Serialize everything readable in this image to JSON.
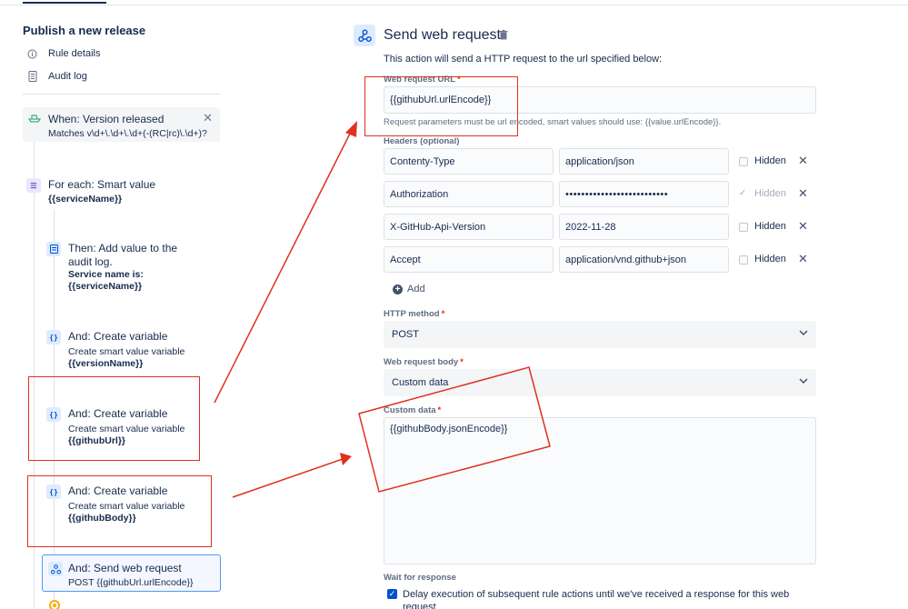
{
  "left": {
    "rule_title": "Publish a new release",
    "links": [
      {
        "label": "Rule details",
        "icon": "info-icon"
      },
      {
        "label": "Audit log",
        "icon": "document-icon"
      }
    ],
    "trigger": {
      "title": "When: Version released",
      "detail": "Matches v\\d+\\.\\d+\\.\\d+(-(RC|rc)\\.\\d+)?"
    },
    "foreach": {
      "title": "For each: Smart value",
      "value": "{{serviceName}}"
    },
    "then": {
      "title_line1": "Then: Add value to the",
      "title_line2": "audit log.",
      "bold_line1": "Service name is:",
      "bold_line2": "{{serviceName}}"
    },
    "create_vars": [
      {
        "title": "And: Create variable",
        "subtitle": "Create smart value variable",
        "name": "{{versionName}}"
      },
      {
        "title": "And: Create variable",
        "subtitle": "Create smart value variable",
        "name": "{{githubUrl}}"
      },
      {
        "title": "And: Create variable",
        "subtitle": "Create smart value variable",
        "name": "{{githubBody}}"
      }
    ],
    "send": {
      "title": "And: Send web request",
      "detail": "POST {{githubUrl.urlEncode}}"
    }
  },
  "right": {
    "heading": "Send web request",
    "description": "This action will send a HTTP request to the url specified below:",
    "url_label": "Web request URL",
    "url_value": "{{githubUrl.urlEncode}}",
    "url_help": "Request parameters must be url encoded, smart values should use: {{value.urlEncode}}.",
    "headers_label": "Headers (optional)",
    "headers": [
      {
        "name": "Contenty-Type",
        "value": "application/json",
        "hidden": false
      },
      {
        "name": "Authorization",
        "value": "••••••••••••••••••••••••••",
        "hidden": true
      },
      {
        "name": "X-GitHub-Api-Version",
        "value": "2022-11-28",
        "hidden": false
      },
      {
        "name": "Accept",
        "value": "application/vnd.github+json",
        "hidden": false
      }
    ],
    "hidden_label": "Hidden",
    "add_label": "Add",
    "method_label": "HTTP method",
    "method_value": "POST",
    "body_label": "Web request body",
    "body_value": "Custom data",
    "custom_label": "Custom data",
    "custom_value": "{{githubBody.jsonEncode}}",
    "wait_label": "Wait for response",
    "delay_text": "Delay execution of subsequent rule actions until we've received a response for this web request"
  },
  "colors": {
    "annotation": "#e0301e",
    "accent": "#0052cc",
    "trigger": "#36b37e"
  }
}
